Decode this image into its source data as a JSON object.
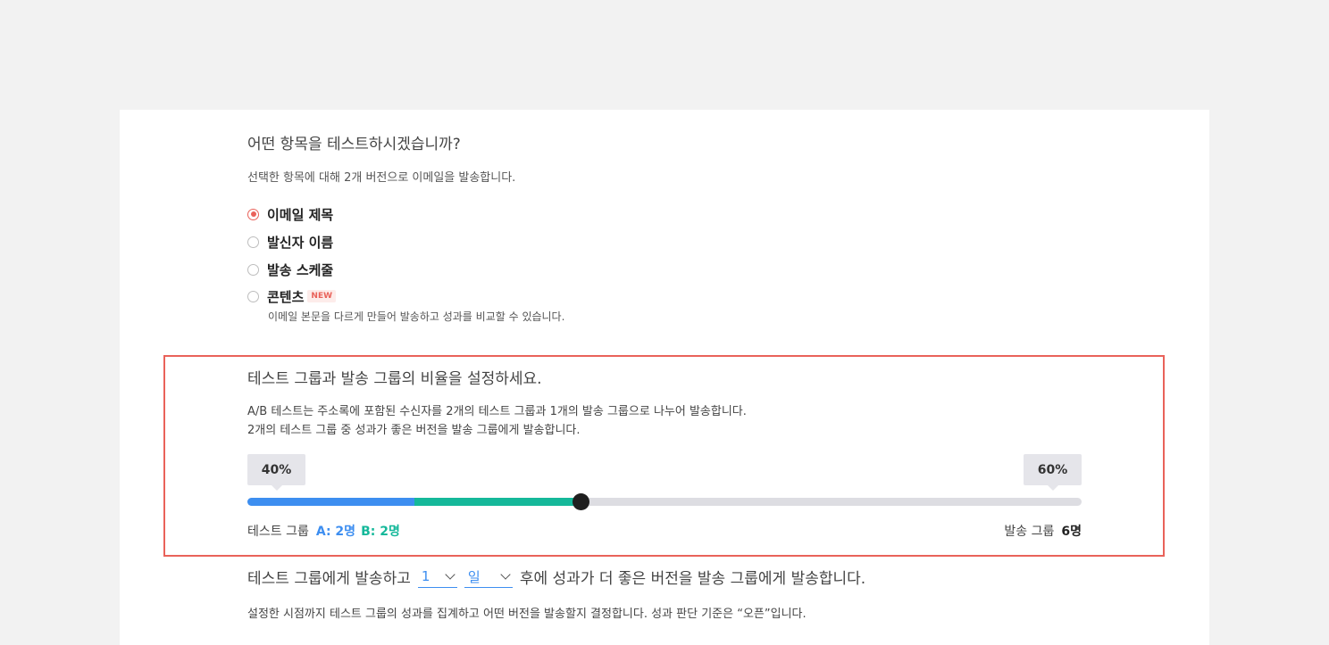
{
  "question": {
    "title": "어떤 항목을 테스트하시겠습니까?",
    "description": "선택한 항목에 대해 2개 버전으로 이메일을 발송합니다.",
    "options": [
      {
        "label": "이메일 제목",
        "checked": true
      },
      {
        "label": "발신자 이름",
        "checked": false
      },
      {
        "label": "발송 스케줄",
        "checked": false
      },
      {
        "label": "콘텐츠",
        "checked": false,
        "badge": "NEW",
        "description": "이메일 본문을 다르게 만들어 발송하고 성과를 비교할 수 있습니다."
      }
    ]
  },
  "ratio": {
    "title": "테스트 그룹과 발송 그룹의 비율을 설정하세요.",
    "description_line1": "A/B 테스트는 주소록에 포함된 수신자를 2개의 테스트 그룹과 1개의 발송 그룹으로 나누어 발송합니다.",
    "description_line2": "2개의 테스트 그룹 중 성과가 좋은 버전을 발송 그룹에게 발송합니다.",
    "test_percent_label": "40%",
    "send_percent_label": "60%",
    "test_fraction": 0.4,
    "group_a_fraction": 0.2,
    "test_group_label": "테스트 그룹",
    "group_a": "A: 2명",
    "group_b": "B: 2명",
    "send_group_label": "발송 그룹",
    "send_group_count": "6명",
    "colors": {
      "group_a": "#3d8ef0",
      "group_b": "#15b89a",
      "highlight": "#e9625a"
    }
  },
  "schedule": {
    "prefix": "테스트 그룹에게 발송하고",
    "amount_value": "1",
    "unit_value": "일",
    "suffix": "후에 성과가 더 좋은 버전을 발송 그룹에게 발송합니다.",
    "description": "설정한 시점까지 테스트 그룹의 성과를 집계하고 어떤 버전을 발송할지 결정합니다. 성과 판단 기준은 “오픈”입니다."
  }
}
